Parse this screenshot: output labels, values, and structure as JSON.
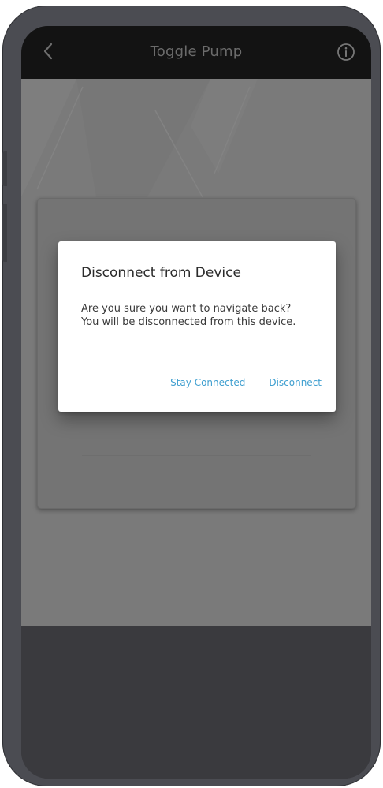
{
  "header": {
    "title": "Toggle Pump",
    "back_icon": "chevron-left-icon",
    "info_icon": "info-icon"
  },
  "dialog": {
    "title": "Disconnect from Device",
    "message_line1": "Are you sure you want to navigate back?",
    "message_line2": "You will be disconnected from this device.",
    "stay_label": "Stay Connected",
    "disconnect_label": "Disconnect"
  },
  "colors": {
    "header_bg": "#131313",
    "overlay_bg": "#7a7a7a",
    "accent": "#3f9fd0",
    "frame": "#4b4c52"
  }
}
